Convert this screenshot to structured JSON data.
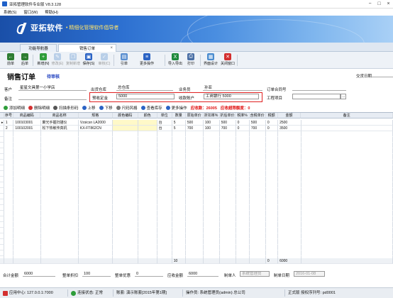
{
  "window": {
    "title": "亚拓管理软件专业版 V8.3.128"
  },
  "menubar": [
    "系统(S)",
    "窗口(W)",
    "帮助(H)"
  ],
  "banner": {
    "brand": "亚拓软件",
    "slogan": "• 精细化管理软件倡导者"
  },
  "tabs": [
    {
      "label": "功能导航器",
      "active": false
    },
    {
      "label": "销售订单",
      "active": true
    }
  ],
  "toolbar": [
    {
      "label": "前单",
      "icon": "arrow-left-icon",
      "color": "#2e7d32",
      "disabled": false
    },
    {
      "label": "后单",
      "icon": "arrow-right-icon",
      "color": "#2e7d32",
      "disabled": false
    },
    {
      "label": "新增(N)",
      "icon": "plus-icon",
      "color": "#2e9d3a",
      "disabled": false
    },
    {
      "label": "修改(E)",
      "icon": "edit-icon",
      "color": "#7aa6d8",
      "disabled": true
    },
    {
      "label": "复制新增",
      "icon": "copy-icon",
      "color": "#7aa6d8",
      "disabled": true
    },
    {
      "label": "保存(S)",
      "icon": "save-icon",
      "color": "#2b63c4",
      "disabled": false
    },
    {
      "label": "审核(C)",
      "icon": "check-icon",
      "color": "#7aa6d8",
      "disabled": true
    },
    {
      "label": "引单",
      "icon": "import-doc-icon",
      "color": "#5b8fd0",
      "disabled": false
    },
    {
      "label": "更多操作",
      "icon": "more-icon",
      "color": "#2b63c4",
      "disabled": false
    },
    {
      "label": "导入导出",
      "icon": "excel-icon",
      "color": "#1f8a3c",
      "disabled": false
    },
    {
      "label": "打印",
      "icon": "print-icon",
      "color": "#4a6fa5",
      "disabled": false
    },
    {
      "label": "界面设计",
      "icon": "design-icon",
      "color": "#4a8ccf",
      "disabled": false
    },
    {
      "label": "关闭窗口",
      "icon": "close-icon",
      "color": "#d32f2f",
      "disabled": false
    }
  ],
  "form": {
    "heading": "销售订单",
    "status": "待审核",
    "date_label": "交货日期",
    "date_value": "",
    "customer_label": "客户",
    "customer_value": "星星文具第一小学店",
    "warehouse_label": "出货仓库",
    "warehouse_value": "总仓库",
    "salesman_label": "业务员",
    "salesman_value": "孙亚",
    "contract_label": "订单合同号",
    "contract_value": "",
    "remark_label": "备注",
    "remark_value": "",
    "deposit_label": "预收定金",
    "deposit_value": "5000",
    "account_label": "收款账户",
    "account_value": "工商银行 5000",
    "project_label": "工程项目",
    "project_value": "",
    "browse_label": "..."
  },
  "grid_tools": [
    {
      "label": "添加明细",
      "color": "#2e9d3a"
    },
    {
      "label": "删除明细",
      "color": "#d32f2f"
    },
    {
      "label": "扫描条形码",
      "color": "#555"
    },
    {
      "label": "上移",
      "color": "#2b63c4"
    },
    {
      "label": "下移",
      "color": "#2b63c4"
    },
    {
      "label": "尺码风格",
      "color": "#777"
    },
    {
      "label": "查看库存",
      "color": "#2b63c4"
    },
    {
      "label": "更多操作",
      "color": "#2b63c4"
    }
  ],
  "receivable": "应收款：26005",
  "credit_overrun": "应收超限额度：0",
  "grid": {
    "columns": [
      "序号",
      "商品编码",
      "商品名称",
      "规格",
      "颜色编码",
      "颜色",
      "单位",
      "数量",
      "原始单价",
      "折扣率%",
      "折后单价",
      "税率%",
      "含税单价",
      "税额",
      "金额",
      "备注"
    ],
    "rows": [
      [
        "1",
        "100103001",
        "聚光手握扫描仪",
        "Vzsicsn LA2000",
        "",
        "",
        "台",
        "5",
        "500",
        "100",
        "500",
        "0",
        "500",
        "0",
        "2500",
        ""
      ],
      [
        "2",
        "100102001",
        "松下热敏传真机",
        "KX-FT862CN",
        "",
        "",
        "台",
        "5",
        "700",
        "100",
        "700",
        "0",
        "700",
        "0",
        "3500",
        ""
      ]
    ],
    "totals": {
      "qty": "10",
      "amount": "6000",
      "tax": "0"
    }
  },
  "footer": {
    "total_label": "合计金额",
    "total_value": "6000",
    "discount_rate_label": "整单折扣",
    "discount_rate_value": "100",
    "discount_amount_label": "整单优惠",
    "discount_amount_value": "0",
    "receivable_total_label": "应收金额",
    "receivable_total_value": "6000",
    "maker_label": "制单人",
    "maker_value": "系统管理员",
    "make_date_label": "制单日期",
    "make_date_value": "2016-01-08"
  },
  "statusbar": {
    "app_center": "应用中心: 127.0.0.1:7000",
    "connection": "连接状态: 正常",
    "account_set": "账套: 演示账套[2015年第1期]",
    "operator": "操作员: 系统管理员(admin) 总公司",
    "license": "正式版 授权序列号: pd0001"
  }
}
